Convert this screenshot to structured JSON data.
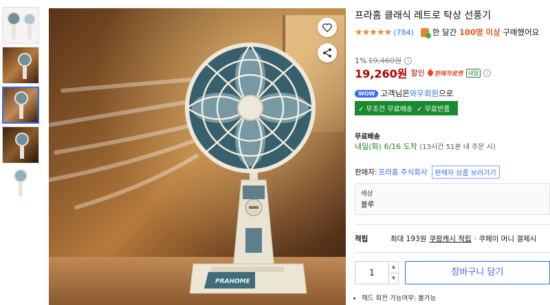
{
  "product": {
    "title": "프라홈 클래식 레트로 탁상 선풍기",
    "stars": "★★★★★",
    "review_count": "(784)",
    "sold_prefix": "한 달간",
    "sold_highlight": "100명 이상",
    "sold_suffix": "구매했어요"
  },
  "price": {
    "discount": "1%",
    "original": "19,460원",
    "current": "19,260원",
    "sale_label": "할인",
    "rocket_label": "판매자로켓",
    "tomorrow_badge": "내일"
  },
  "wow": {
    "badge": "WOW",
    "text_before": "고객님은",
    "link": "와우회원",
    "text_after": "으로",
    "benefits": [
      "✓ 무조건 무료배송",
      "✓ 무료반품"
    ]
  },
  "shipping": {
    "label": "무료배송",
    "date": "내일(화) 6/16",
    "arrive": "도착",
    "note": "(13시간 51분 내 주문 시)"
  },
  "seller": {
    "label": "판매자:",
    "name": "프라홈 주식회사",
    "more_button": "판매자 상품 보러가기"
  },
  "option": {
    "label": "색상",
    "value": "블루"
  },
  "points": {
    "label": "적립",
    "text": "최대 193원",
    "link": "쿠팡캐시 적립",
    "suffix": "· 쿠페이 머니 결제시"
  },
  "purchase": {
    "quantity": "1",
    "cart_button": "장바구니 담기"
  },
  "details": [
    "헤드 회전 가능여부: 불가능"
  ],
  "image": {
    "brand_text": "PRAHOME"
  },
  "colors": {
    "accent": "#346aff",
    "price_red": "#ae0000",
    "green": "#1a8a2f",
    "star": "#f5832a"
  }
}
